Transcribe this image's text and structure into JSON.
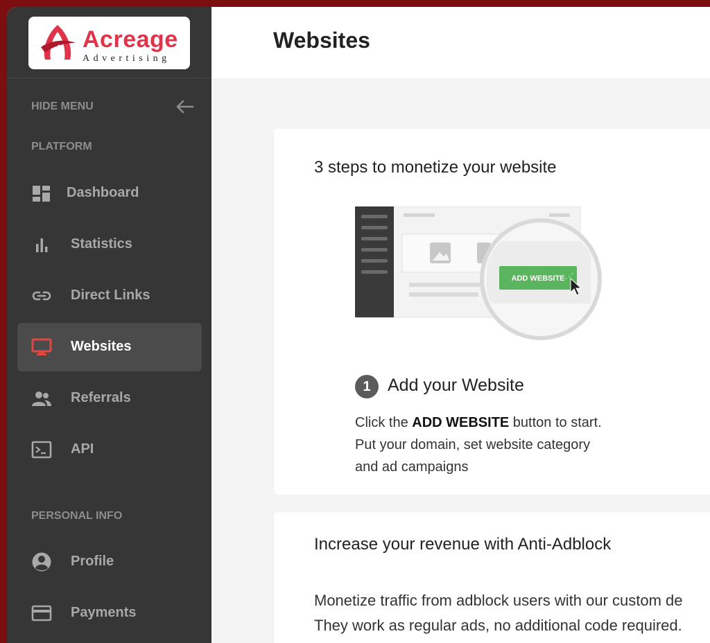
{
  "brand": {
    "name": "Acreage",
    "tagline": "Advertising",
    "accent": "#e0344b",
    "frame_color": "#7d0e10"
  },
  "sidebar": {
    "hide_menu_label": "HIDE MENU",
    "platform_section": "PLATFORM",
    "personal_section": "PERSONAL INFO",
    "items": [
      {
        "label": "Dashboard",
        "icon": "dashboard-icon",
        "active": false
      },
      {
        "label": "Statistics",
        "icon": "bar-chart-icon",
        "active": false
      },
      {
        "label": "Direct Links",
        "icon": "link-icon",
        "active": false
      },
      {
        "label": "Websites",
        "icon": "monitor-icon",
        "active": true
      },
      {
        "label": "Referrals",
        "icon": "people-icon",
        "active": false
      },
      {
        "label": "API",
        "icon": "terminal-icon",
        "active": false
      }
    ],
    "personal_items": [
      {
        "label": "Profile",
        "icon": "account-circle-icon"
      },
      {
        "label": "Payments",
        "icon": "credit-card-icon"
      }
    ]
  },
  "header": {
    "title": "Websites"
  },
  "steps_card": {
    "title": "3 steps to monetize your website",
    "illustration_button": "ADD WEBSITE",
    "step_number": "1",
    "step_title": "Add your Website",
    "desc_prefix": "Click the ",
    "desc_bold": "ADD WEBSITE",
    "desc_suffix": " button to start.",
    "desc_line2": "Put your domain, set website category",
    "desc_line3": "and ad campaigns"
  },
  "adblock_card": {
    "title": "Increase your revenue with Anti-Adblock",
    "line1": "Monetize traffic from adblock users with our custom de",
    "line2": "They work as regular ads, no additional code required."
  }
}
